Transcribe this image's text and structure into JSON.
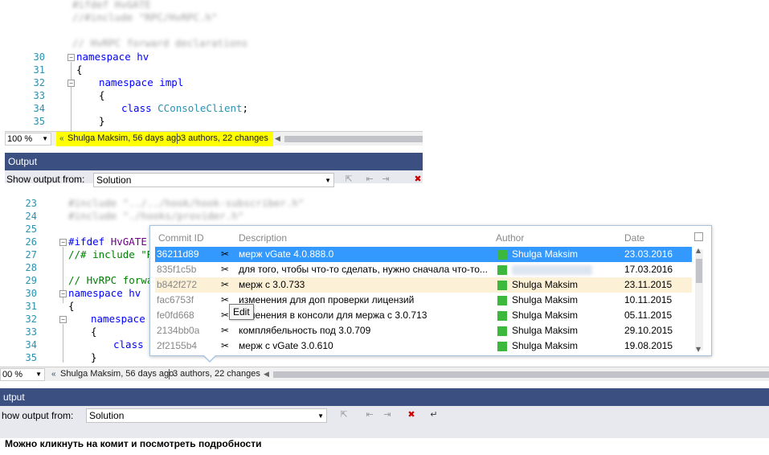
{
  "top_editor": {
    "lines": [
      {
        "num": "",
        "text": "//#include \"RPC/HvRPC.h\""
      },
      {
        "num": "",
        "text": ""
      },
      {
        "num": "",
        "text": "// HvRPC forward declarations"
      },
      {
        "num": "30",
        "text": "namespace hv"
      },
      {
        "num": "31",
        "text": "{"
      },
      {
        "num": "32",
        "text": "namespace impl"
      },
      {
        "num": "33",
        "text": "{"
      },
      {
        "num": "34",
        "text": "class CConsoleClient;"
      },
      {
        "num": "35",
        "text": "}"
      }
    ],
    "zoom": "100 %",
    "codelens_author": "Shulga Maksim, 56 days ago",
    "codelens_changes": "3 authors, 22 changes",
    "output_title": "Output",
    "show_output_label": "Show output from:",
    "show_output_value": "Solution"
  },
  "bottom_editor": {
    "lines": [
      {
        "num": "23",
        "text": "#include \"../../hook/hook-subscriber.h\""
      },
      {
        "num": "24",
        "text": "#include \"./hooks/provider.h\""
      },
      {
        "num": "25",
        "text": ""
      },
      {
        "num": "26",
        "kw": "#ifdef ",
        "mac": "HvGATE"
      },
      {
        "num": "27",
        "text": "//# include \"RP"
      },
      {
        "num": "28",
        "text": ""
      },
      {
        "num": "29",
        "text": "// HvRPC forwar"
      },
      {
        "num": "30",
        "text": "namespace hv"
      },
      {
        "num": "31",
        "text": "{"
      },
      {
        "num": "32",
        "text": "namespace i"
      },
      {
        "num": "33",
        "text": "{"
      },
      {
        "num": "34",
        "text": "class C"
      },
      {
        "num": "35",
        "text": "}"
      }
    ],
    "zoom": "00 %",
    "codelens_author": "Shulga Maksim, 56 days ago",
    "codelens_changes": "3 authors, 22 changes",
    "output_title": "utput",
    "show_output_label": "how output from:",
    "show_output_value": "Solution"
  },
  "popup": {
    "headers": {
      "commit": "Commit ID",
      "description": "Description",
      "author": "Author",
      "date": "Date"
    },
    "tooltip": "Edit",
    "rows": [
      {
        "id": "36211d89",
        "desc": "мерж vGate 4.0.888.0",
        "author": "Shulga Maksim",
        "date": "23.03.2016",
        "state": "selected"
      },
      {
        "id": "835f1c5b",
        "desc": "для того, чтобы что-то сделать, нужно сначала что-то...",
        "author": "",
        "date": "17.03.2016",
        "state": ""
      },
      {
        "id": "b842f272",
        "desc": "мерж с 3.0.733",
        "author": "Shulga Maksim",
        "date": "23.11.2015",
        "state": "hover"
      },
      {
        "id": "fac6753f",
        "desc": "изменения для доп проверки лицензий",
        "author": "Shulga Maksim",
        "date": "10.11.2015",
        "state": ""
      },
      {
        "id": "fe0fd668",
        "desc": "изменения в консоли для мержа с 3.0.713",
        "author": "Shulga Maksim",
        "date": "05.11.2015",
        "state": ""
      },
      {
        "id": "2134bb0a",
        "desc": "комплябельность под 3.0.709",
        "author": "Shulga Maksim",
        "date": "29.10.2015",
        "state": ""
      },
      {
        "id": "2f2155b4",
        "desc": "мерж с vGate 3.0.610",
        "author": "Shulga Maksim",
        "date": "19.08.2015",
        "state": ""
      }
    ]
  },
  "caption": "Можно кликнуть на комит и посмотреть подробности",
  "colors": {
    "highlight": "#ffff00",
    "selected_row": "#3399ff",
    "hover_row": "#fcf1d7",
    "author_swatch": "#3cb93c",
    "output_bar": "#3b4f81"
  }
}
